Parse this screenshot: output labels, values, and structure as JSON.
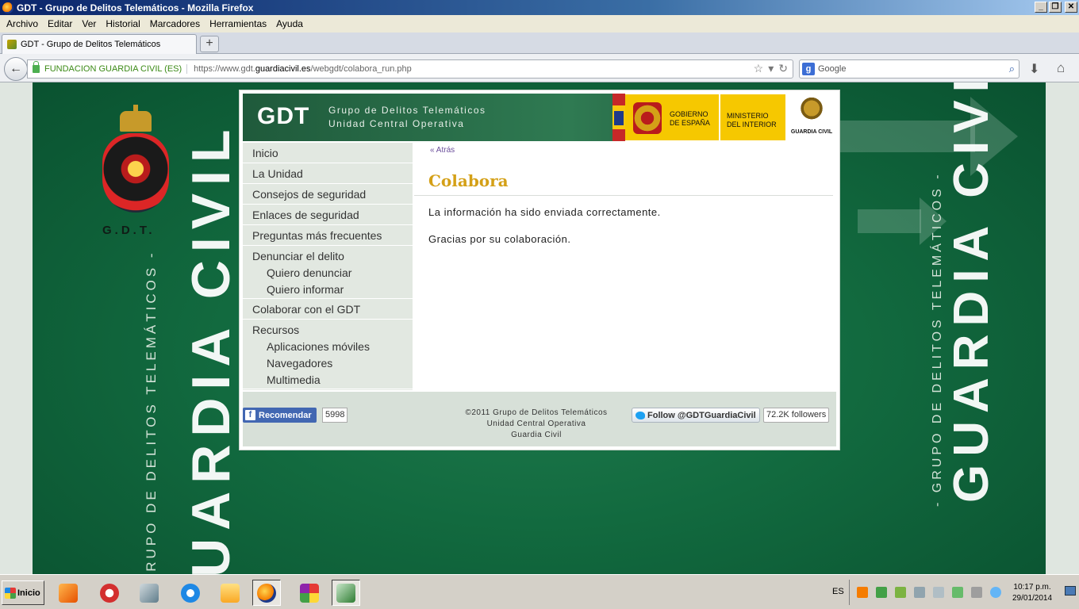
{
  "window": {
    "title": "GDT - Grupo de Delitos Telemáticos - Mozilla Firefox",
    "controls": {
      "minimize": "_",
      "restore": "❐",
      "close": "✕"
    }
  },
  "menu": [
    "Archivo",
    "Editar",
    "Ver",
    "Historial",
    "Marcadores",
    "Herramientas",
    "Ayuda"
  ],
  "tabs": [
    {
      "label": "GDT - Grupo de Delitos Telemáticos",
      "active": true
    }
  ],
  "new_tab_label": "+",
  "navbar": {
    "identity": "FUNDACION GUARDIA CIVIL (ES)",
    "url_prefix": "https://www.gdt.",
    "url_domain": "guardiacivil.es",
    "url_path": "/webgdt/colabora_run.php",
    "search_placeholder": "Google"
  },
  "site": {
    "logo": "GDT",
    "header_line1": "Grupo de Delitos Telemáticos",
    "header_line2": "Unidad Central Operativa",
    "gobierno_line1": "GOBIERNO",
    "gobierno_line2": "DE ESPAÑA",
    "ministerio_line1": "MINISTERIO",
    "ministerio_line2": "DEL INTERIOR",
    "guardia_civil_logo": "GUARDIA CIVIL",
    "bg_mark": "G.D.T.",
    "bg_big_text": "GUARDIA CIVIL",
    "bg_small_text": "- GRUPO DE DELITOS TELEMÁTICOS -",
    "bg_small_text_left": "GRUPO DE DELITOS TELEMÁTICOS -",
    "bg_big_text_left": "UARDIA CIVIL"
  },
  "sidebar": {
    "items": [
      {
        "label": "Inicio"
      },
      {
        "label": "La Unidad"
      },
      {
        "label": "Consejos de seguridad"
      },
      {
        "label": "Enlaces de seguridad"
      },
      {
        "label": "Preguntas más frecuentes"
      }
    ],
    "denunciar": {
      "label": "Denunciar el delito",
      "subs": [
        "Quiero denunciar",
        "Quiero informar"
      ]
    },
    "colaborar": "Colaborar con el GDT",
    "recursos": {
      "label": "Recursos",
      "subs": [
        "Aplicaciones móviles",
        "Navegadores",
        "Multimedia"
      ]
    }
  },
  "content": {
    "back_link": "« Atrás",
    "title": "Colabora",
    "message1": "La información ha sido enviada correctamente.",
    "message2": "Gracias por su colaboración."
  },
  "footer": {
    "fb_label": "Recomendar",
    "fb_count": "5998",
    "line1": "©2011 Grupo de Delitos Telemáticos",
    "line2": "Unidad Central Operativa",
    "line3": "Guardia Civil",
    "tw_label": "Follow @GDTGuardiaCivil",
    "tw_count": "72.2K followers"
  },
  "taskbar": {
    "start_label": "Inicio",
    "lang": "ES",
    "time": "10:17 p.m.",
    "date": "29/01/2014"
  }
}
